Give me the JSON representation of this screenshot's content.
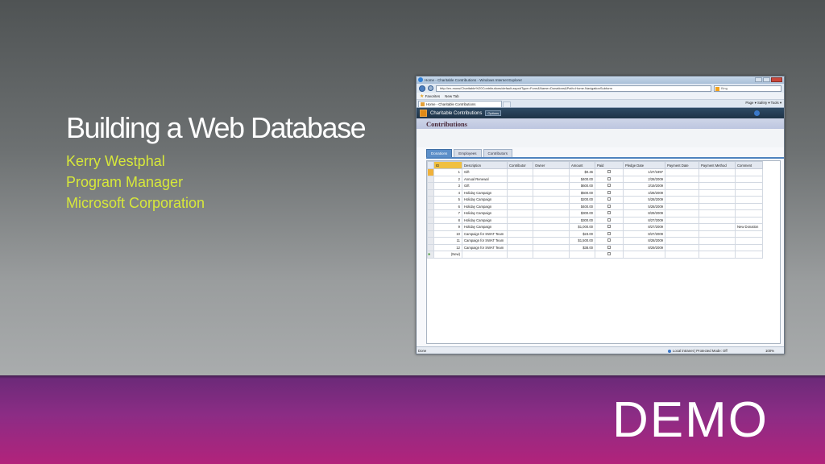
{
  "slide": {
    "title": "Building a Web Database",
    "subtitle_lines": [
      "Kerry Westphal",
      "Program Manager",
      "Microsoft Corporation"
    ],
    "demo_label": "DEMO",
    "colors": {
      "subtitle": "#d7e83a",
      "band_start": "#6a2a78",
      "band_end": "#b2237b"
    }
  },
  "browser": {
    "window_title": "Home - Charitable Contributions - Windows Internet Explorer",
    "address": "http://ex-moss/Charitable%20Contributions/default.aspx#Type=Form&Name=Donations&Path=Home.NavigationSubform",
    "search_placeholder": "Bing",
    "favorites_label": "Favorites",
    "newtab_label": "New Tab",
    "active_tab": "Home - Charitable Contributions",
    "command_bar": "Page ▾  Safety ▾  Tools ▾",
    "status_left": "Done",
    "status_zone": "Local intranet | Protected Mode: Off",
    "status_zoom": "100%"
  },
  "app": {
    "name": "Charitable Contributions",
    "options_label": "Options",
    "form_title": "Contributions",
    "form_tabs": [
      "Donations",
      "Employees",
      "Contributors"
    ],
    "columns": [
      "ID",
      "Description",
      "Contributor",
      "Owner",
      "Amount",
      "Paid",
      "Pledge Date",
      "Payment Date",
      "Payment Method",
      "Comment"
    ],
    "rows": [
      {
        "id": "1",
        "desc": "Gift",
        "amount": "$0.46",
        "date": "1/27/1997",
        "comment": ""
      },
      {
        "id": "2",
        "desc": "Annual Renewal",
        "amount": "$400.00",
        "date": "2/28/2009",
        "comment": ""
      },
      {
        "id": "3",
        "desc": "Gift",
        "amount": "$600.00",
        "date": "3/19/2009",
        "comment": ""
      },
      {
        "id": "4",
        "desc": "Holiday Campaign",
        "amount": "$500.00",
        "date": "4/28/2009",
        "comment": ""
      },
      {
        "id": "5",
        "desc": "Holiday Campaign",
        "amount": "$200.00",
        "date": "5/28/2009",
        "comment": ""
      },
      {
        "id": "6",
        "desc": "Holiday Campaign",
        "amount": "$400.00",
        "date": "5/28/2009",
        "comment": ""
      },
      {
        "id": "7",
        "desc": "Holiday Campaign",
        "amount": "$300.00",
        "date": "8/29/2009",
        "comment": ""
      },
      {
        "id": "8",
        "desc": "Holiday Campaign",
        "amount": "$300.00",
        "date": "8/27/2009",
        "comment": ""
      },
      {
        "id": "9",
        "desc": "Holiday Campaign",
        "amount": "$1,000.00",
        "date": "8/27/2009",
        "comment": "New Donation"
      },
      {
        "id": "10",
        "desc": "Campaign for SWAT Team",
        "amount": "$23.00",
        "date": "8/27/2009",
        "comment": ""
      },
      {
        "id": "11",
        "desc": "Campaign for SWAT Team",
        "amount": "$1,500.00",
        "date": "8/28/2009",
        "comment": ""
      },
      {
        "id": "12",
        "desc": "Campaign for SWAT Team",
        "amount": "$38.00",
        "date": "8/29/2009",
        "comment": ""
      }
    ],
    "new_row_label": "(New)"
  }
}
